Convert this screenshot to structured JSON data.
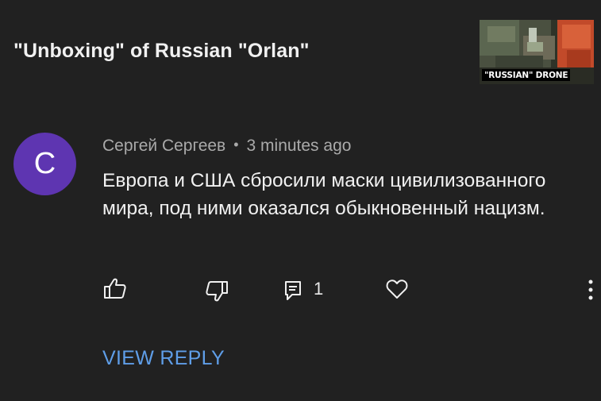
{
  "video": {
    "title": "\"Unboxing\" of Russian \"Orlan\"",
    "thumbnail_caption": "\"RUSSIAN\" DRONE"
  },
  "comment": {
    "avatar_letter": "C",
    "avatar_color": "#5e35b1",
    "author": "Сергей Сергеев",
    "separator": "•",
    "time": "3 minutes ago",
    "text": "Европа и США сбросили маски цивилизованного мира, под ними оказался обыкновенный нацизм.",
    "reply_count": "1",
    "view_reply_label": "VIEW REPLY"
  },
  "actions": {
    "like_icon": "thumbs-up-icon",
    "dislike_icon": "thumbs-down-icon",
    "reply_icon": "comment-icon",
    "heart_icon": "heart-icon",
    "more_icon": "more-vert-icon"
  },
  "colors": {
    "background": "#212121",
    "accent_link": "#5f9ee8",
    "secondary_text": "#aaaaaa"
  }
}
